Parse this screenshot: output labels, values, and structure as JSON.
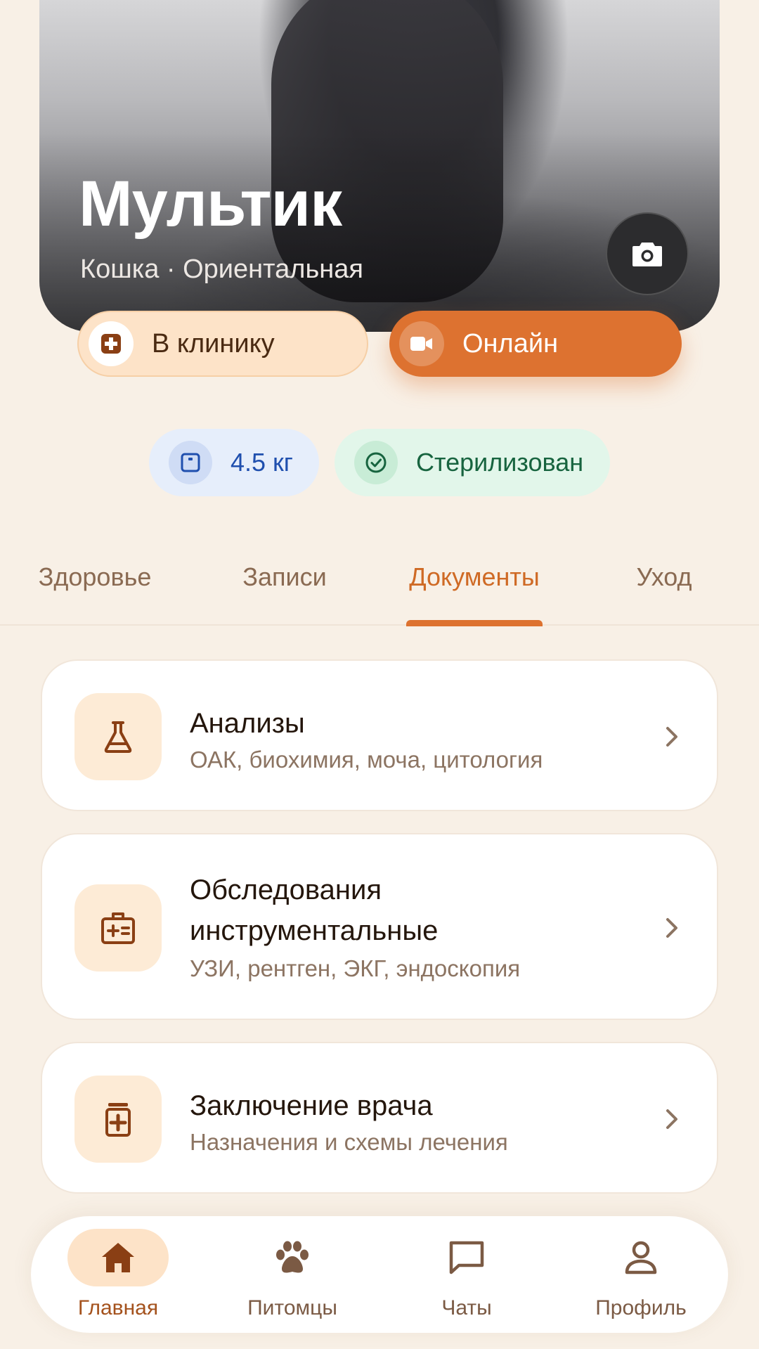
{
  "pet": {
    "name": "Мультик",
    "subtitle": "Кошка · Ориентальная"
  },
  "actions": {
    "clinic_label": "В клинику",
    "online_label": "Онлайн"
  },
  "chips": {
    "weight": "4.5 кг",
    "sterilized": "Стерилизован"
  },
  "tabs": [
    {
      "label": "Здоровье",
      "active": false
    },
    {
      "label": "Записи",
      "active": false
    },
    {
      "label": "Документы",
      "active": true
    },
    {
      "label": "Уход",
      "active": false
    }
  ],
  "documents": [
    {
      "title": "Анализы",
      "description": "ОАК, биохимия, моча, цитология",
      "icon": "flask-icon"
    },
    {
      "title": "Обследования инструментальные",
      "title_line1": "Обследования",
      "title_line2": "инструментальные",
      "description": "УЗИ, рентген, ЭКГ, эндоскопия",
      "icon": "medical-kit-icon"
    },
    {
      "title": "Заключение врача",
      "description": "Назначения и схемы лечения",
      "icon": "medicine-jar-icon"
    }
  ],
  "nav": [
    {
      "label": "Главная",
      "icon": "home-icon",
      "active": true
    },
    {
      "label": "Питомцы",
      "icon": "paw-icon",
      "active": false
    },
    {
      "label": "Чаты",
      "icon": "chat-icon",
      "active": false
    },
    {
      "label": "Профиль",
      "icon": "user-icon",
      "active": false
    }
  ],
  "colors": {
    "background": "#f8f0e6",
    "accent": "#dd7230",
    "accent_soft": "#fde3c8",
    "weight_chip": "#e6eefb",
    "steril_chip": "#e2f6ea"
  }
}
